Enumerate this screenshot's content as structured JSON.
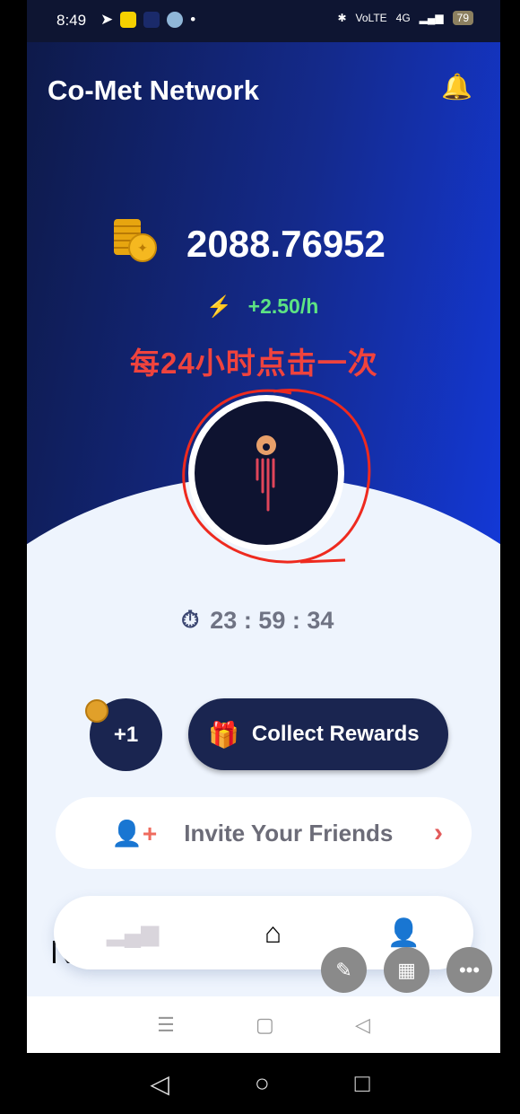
{
  "status_bar": {
    "time": "8:49",
    "battery": "79",
    "network": "4G"
  },
  "header": {
    "title": "Co-Met Network"
  },
  "balance": {
    "value": "2088.76952",
    "rate": "+2.50/h"
  },
  "annotation": "每24小时点击一次",
  "timer": "23 : 59 : 34",
  "actions": {
    "plus_one": "+1",
    "collect_label": "Collect Rewards",
    "invite_label": "Invite Your Friends"
  },
  "partial_text": "N",
  "nav": {
    "items": [
      {
        "icon": "chart-icon",
        "active": false
      },
      {
        "icon": "home-icon",
        "active": true
      },
      {
        "icon": "profile-icon",
        "active": false
      }
    ]
  },
  "colors": {
    "accent": "#1338d6",
    "dark": "#1a2550",
    "rate": "#5de383",
    "annotation": "#f0433d"
  }
}
